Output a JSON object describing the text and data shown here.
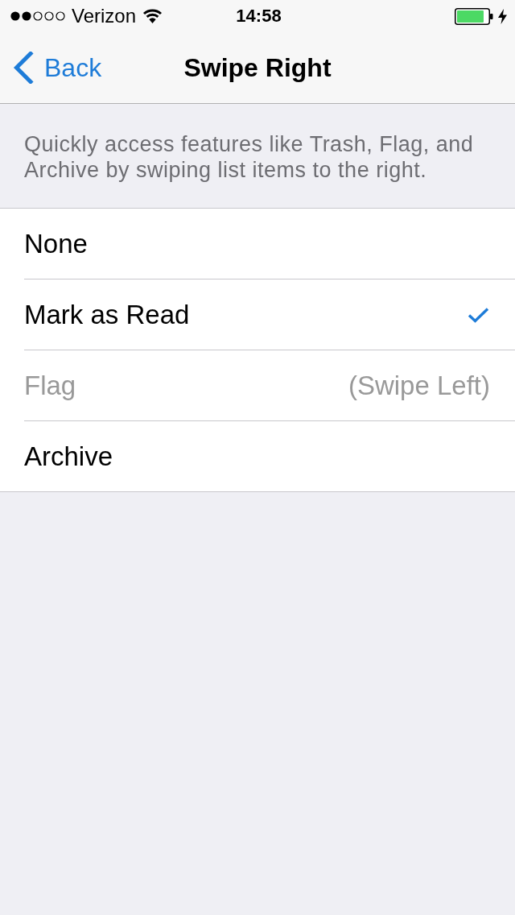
{
  "status_bar": {
    "carrier": "Verizon",
    "time": "14:58"
  },
  "nav_bar": {
    "back": "Back",
    "title": "Swipe Right"
  },
  "description": "Quickly access features like Trash, Flag, and Archive by swiping list items to the right.",
  "options": [
    {
      "label": "None",
      "selected": false,
      "disabled": false
    },
    {
      "label": "Mark as Read",
      "selected": true,
      "disabled": false
    },
    {
      "label": "Flag",
      "selected": false,
      "disabled": true,
      "detail": "(Swipe Left)"
    },
    {
      "label": "Archive",
      "selected": false,
      "disabled": false
    }
  ]
}
